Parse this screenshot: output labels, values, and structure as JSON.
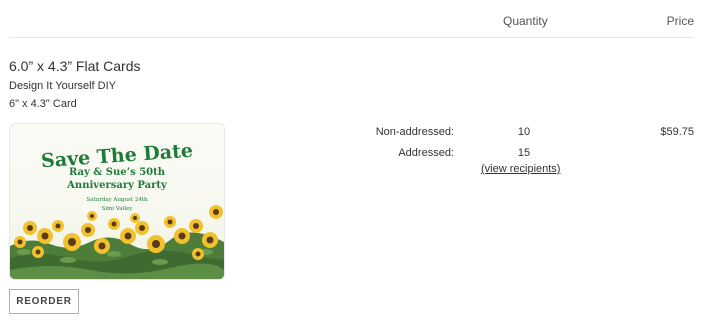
{
  "columns": {
    "quantity": "Quantity",
    "price": "Price"
  },
  "item": {
    "title": "6.0” x 4.3” Flat Cards",
    "subtitle": "Design It Yourself DIY",
    "size": "6\" x 4.3\" Card",
    "card": {
      "headline": "Save The Date",
      "line1": "Ray & Sue’s 50th",
      "line2": "Anniversary Party",
      "date": "Saturday August 24th",
      "location": "Simi Valley"
    },
    "rows": [
      {
        "label": "Non-addressed:",
        "quantity": "10"
      },
      {
        "label": "Addressed:",
        "quantity": "15"
      }
    ],
    "recipients_link": "(view recipients)",
    "price": "$59.75",
    "reorder_label": "REORDER"
  },
  "colors": {
    "card_green": "#1f7a3a",
    "sunflower": "#f2c12e",
    "leaf": "#4e7d3a"
  }
}
